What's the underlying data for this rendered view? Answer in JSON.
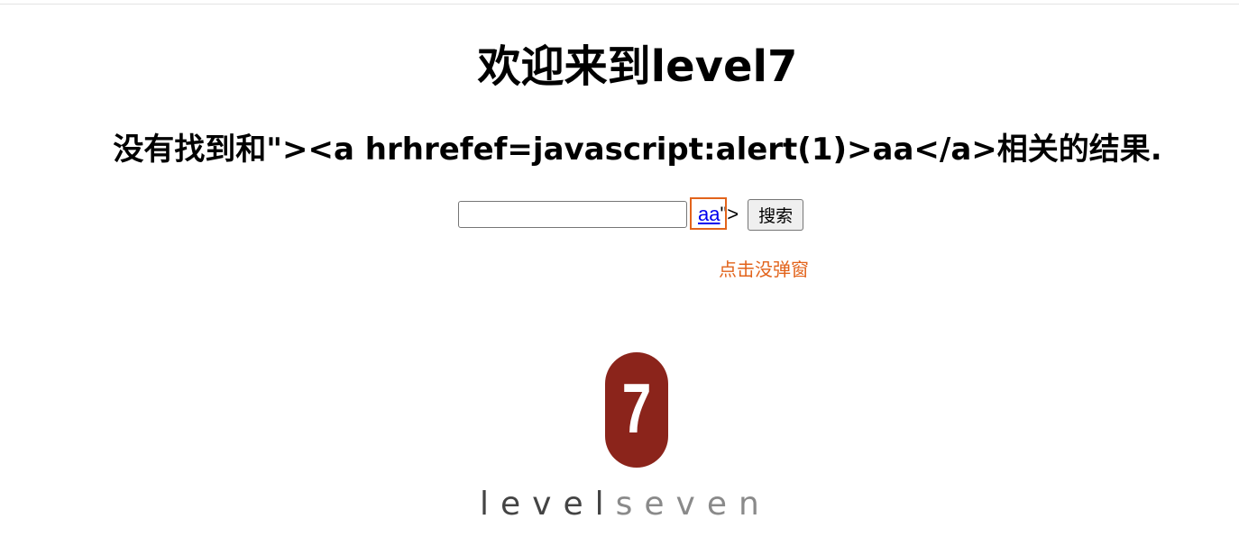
{
  "page": {
    "title": "欢迎来到level7",
    "result_heading": "没有找到和\"><a hrhrefef=javascript:alert(1)>aa</a>相关的结果."
  },
  "search": {
    "input_value": "",
    "link_text": "aa",
    "trailing_text": "\">",
    "button_label": "搜索"
  },
  "annotation": {
    "text": "点击没弹窗",
    "color": "#e2631b"
  },
  "logo": {
    "digit": "7",
    "wordmark_dark": "level",
    "wordmark_light": "seven",
    "pill_color": "#8b241b"
  }
}
